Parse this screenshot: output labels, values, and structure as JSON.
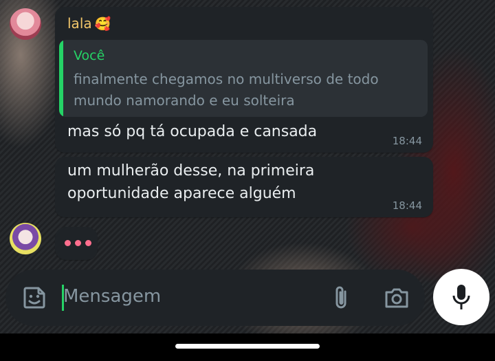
{
  "chat": {
    "messages": [
      {
        "sender": "lala",
        "sender_emoji": "🥰",
        "quote_author": "Você",
        "quote_text": "finalmente chegamos no multiverso de todo mundo namorando e eu solteira",
        "text": "mas só pq tá ocupada e cansada",
        "time": "18:44"
      },
      {
        "text": "um mulherão desse, na primeira oportunidade aparece alguém",
        "time": "18:44"
      }
    ],
    "typing_indicator": "typing-dots"
  },
  "composer": {
    "placeholder": "Mensagem",
    "icons": [
      "sticker-icon",
      "paperclip-icon",
      "camera-icon",
      "microphone-icon"
    ]
  },
  "colors": {
    "sender_name": "#f2c66a",
    "accent_green": "#25d366",
    "typing_dots": "#ff6f8e",
    "bubble_bg": "#1f2327"
  }
}
